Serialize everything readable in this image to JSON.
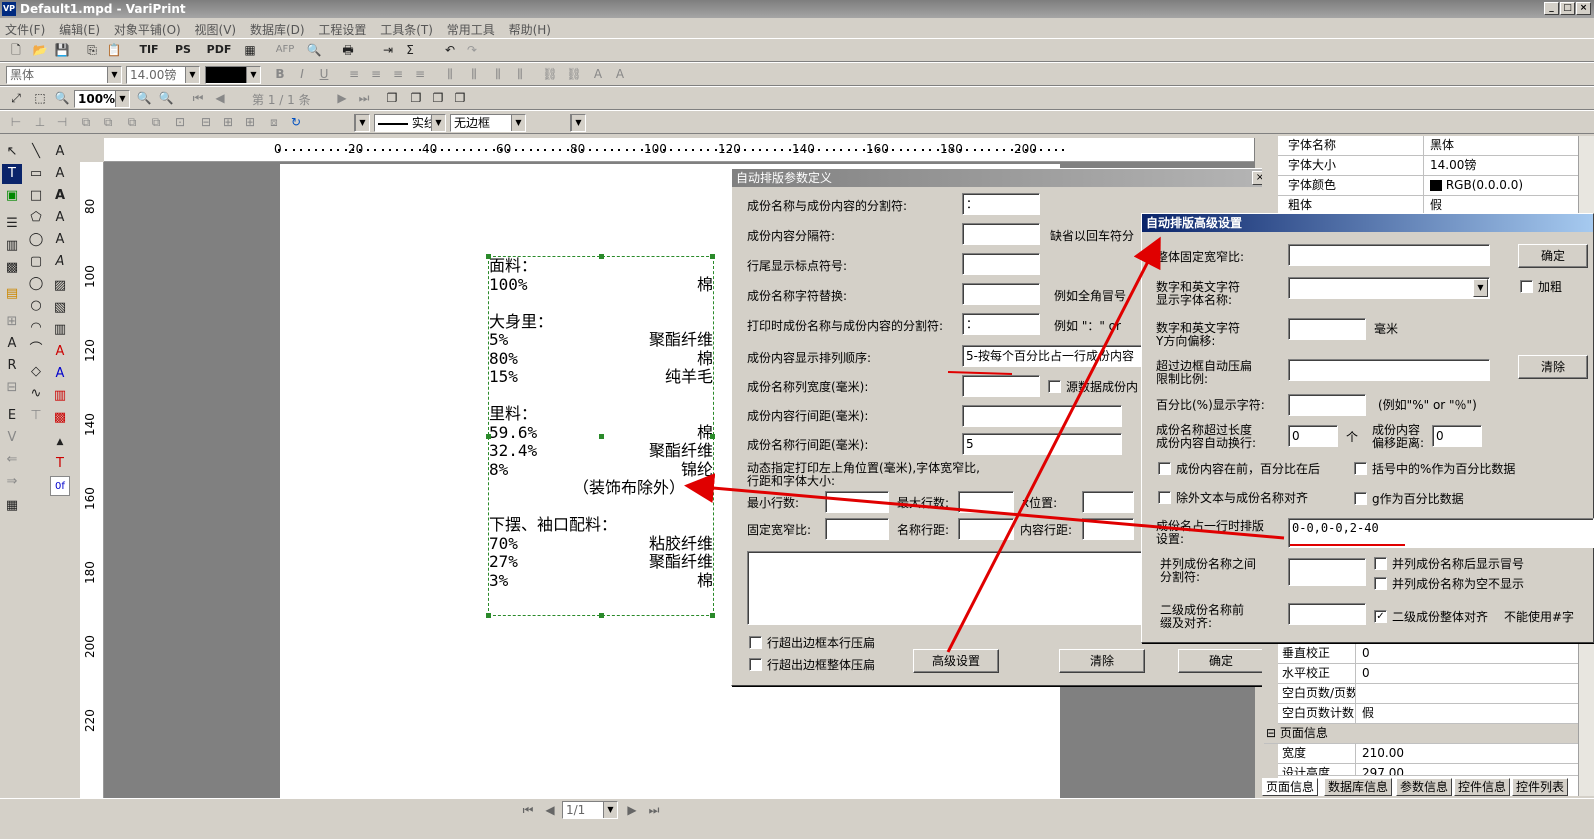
{
  "window": {
    "icon": "VP",
    "title": "Default1.mpd - VariPrint",
    "min": "_",
    "max": "□",
    "close": "×"
  },
  "menu": [
    "文件(F)",
    "编辑(E)",
    "对象平铺(O)",
    "视图(V)",
    "数据库(D)",
    "工程设置",
    "工具条(T)",
    "常用工具",
    "帮助(H)"
  ],
  "toolbar1": {
    "tif": "TIF",
    "ps": "PS",
    "pdf": "PDF",
    "afp": "AFP"
  },
  "format_bar": {
    "font": "黑体",
    "size": "14.00镑",
    "bold": "B",
    "italic": "I",
    "underline": "U"
  },
  "view_bar": {
    "zoom": "100%",
    "page": "第 1 / 1 条"
  },
  "line_bar": {
    "line_style": "实线",
    "border": "无边框"
  },
  "ruler_top": [
    "0",
    "20",
    "40",
    "60",
    "80",
    "100",
    "120",
    "140",
    "160",
    "180",
    "200"
  ],
  "ruler_left": [
    "80",
    "100",
    "120",
    "140",
    "160",
    "180",
    "200",
    "220"
  ],
  "textbox": {
    "lines": [
      {
        "l": "面料：",
        "r": ""
      },
      {
        "l": "100%",
        "r": "棉"
      },
      {
        "l": " ",
        "r": ""
      },
      {
        "l": "大身里：",
        "r": ""
      },
      {
        "l": "5%",
        "r": "聚酯纤维"
      },
      {
        "l": "80%",
        "r": "棉"
      },
      {
        "l": "15%",
        "r": "纯羊毛"
      },
      {
        "l": " ",
        "r": ""
      },
      {
        "l": "里料：",
        "r": ""
      },
      {
        "l": "59.6%",
        "r": "棉"
      },
      {
        "l": "32.4%",
        "r": "聚酯纤维"
      },
      {
        "l": "8%",
        "r": "锦纶"
      },
      {
        "l": "",
        "r": "（装饰布除外）"
      },
      {
        "l": " ",
        "r": ""
      },
      {
        "l": "下摆、袖口配料：",
        "r": ""
      },
      {
        "l": "70%",
        "r": "粘胶纤维"
      },
      {
        "l": "27%",
        "r": "聚酯纤维"
      },
      {
        "l": "3%",
        "r": "棉"
      }
    ]
  },
  "dlg1": {
    "title": "自动排版参数定义",
    "sep_label": "成份名称与成份内容的分割符:",
    "sep_value": "：",
    "content_sep_label": "成份内容分隔符:",
    "content_sep_note": "缺省以回车符分",
    "line_end_label": "行尾显示标点符号:",
    "replace_label": "成份名称字符替换:",
    "replace_note": "例如全角冒号",
    "print_sep_label": "打印时成份名称与成份内容的分割符:",
    "print_sep_value": "：",
    "print_sep_note": "例如 \"：\" or",
    "order_label": "成份内容显示排列顺序:",
    "order_value": "5-按每个百分比占一行成份内容",
    "name_width_label": "成份名称列宽度(毫米):",
    "src_chk": "源数据成份内",
    "content_spacing_label": "成份内容行间距(毫米):",
    "name_spacing_label": "成份名称行间距(毫米):",
    "name_spacing_value": "5",
    "dynamic_label1": "动态指定打印左上角位置(毫米),字体宽窄比,",
    "dynamic_label2": "行距和字体大小:",
    "min_rows": "最小行数:",
    "max_rows": "最大行数:",
    "xpos": "x位置:",
    "fixed_ratio": "固定宽窄比:",
    "name_spacing2": "名称行距:",
    "content_spacing2": "内容行距:",
    "chk_row": "行超出边框本行压扁",
    "chk_all": "行超出边框整体压扁",
    "btn_adv": "高级设置",
    "btn_clear": "清除",
    "btn_ok": "确定",
    "close": "×"
  },
  "dlg2": {
    "title": "自动排版高级设置",
    "fixed_ratio": "整体固定宽窄比:",
    "font_name_label1": "数字和英文字符",
    "font_name_label2": "显示字体名称:",
    "yoffset_label1": "数字和英文字符",
    "yoffset_label2": "Y方向偏移:",
    "yoffset_unit": "毫米",
    "compress_label1": "超过边框自动压扁",
    "compress_label2": "限制比例:",
    "percent_label": "百分比(%)显示字符:",
    "percent_note": "(例如\"%\" or \"％\")",
    "wrap_label1": "成份名称超过长度",
    "wrap_label2": "成份内容自动换行:",
    "wrap_value": "0",
    "wrap_unit": "个",
    "offset_label1": "成份内容",
    "offset_label2": "偏移距离:",
    "offset_value": "0",
    "chk_content_first": "成份内容在前，百分比在后",
    "chk_bracket": "括号中的%作为百分比数据",
    "chk_align": "除外文本与成份名称对齐",
    "chk_g": "g作为百分比数据",
    "oneline_label1": "成份名占一行时排版",
    "oneline_label2": "设置:",
    "oneline_value": "0-0,0-0,2-40",
    "parallel_label1": "并列成份名称之间",
    "parallel_label2": "分割符:",
    "chk_colon": "并列成份名称后显示冒号",
    "chk_empty": "并列成份名称为空不显示",
    "second_label1": "二级成份名称前",
    "second_label2": "缀及对齐:",
    "chk_second": "二级成份整体对齐",
    "note_hash": "不能使用#字",
    "btn_ok": "确定",
    "btn_clear": "清除",
    "chk_bold": "加粗"
  },
  "props": {
    "rows": [
      {
        "k": "字体名称",
        "v": "黑体"
      },
      {
        "k": "字体大小",
        "v": "14.00镑"
      },
      {
        "k": "字体颜色",
        "v": "RGB(0.0.0.0)"
      },
      {
        "k": "粗体",
        "v": "假"
      }
    ],
    "rows2": [
      {
        "k": "垂直校正",
        "v": "0"
      },
      {
        "k": "水平校正",
        "v": "0"
      },
      {
        "k": "空白页数/页数",
        "v": ""
      },
      {
        "k": "空白页数计数",
        "v": "假"
      }
    ],
    "section": "页面信息",
    "rows3": [
      {
        "k": "宽度",
        "v": "210.00"
      },
      {
        "k": "设计高度",
        "v": "297.00"
      }
    ]
  },
  "tabs": [
    "页面信息",
    "数据库信息",
    "参数信息",
    "控件信息",
    "控件列表"
  ],
  "status": {
    "page": "1/1"
  },
  "colors": {
    "arrow": "#e00000",
    "title_active": "#0a246a"
  }
}
